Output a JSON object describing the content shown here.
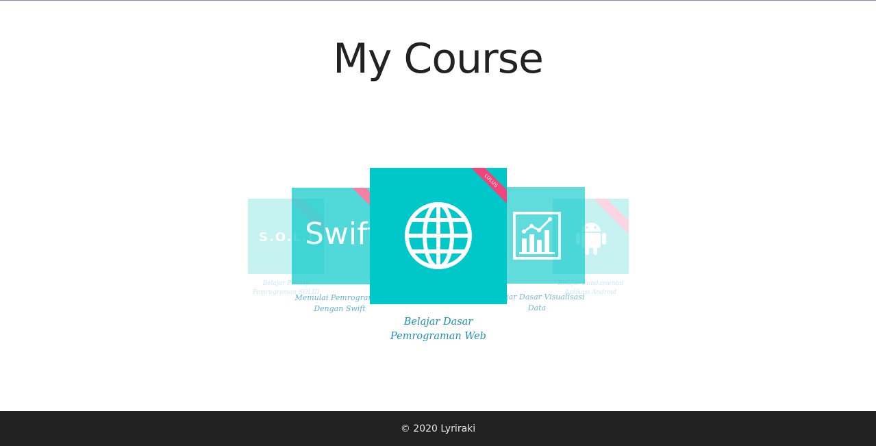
{
  "page": {
    "title": "My Course"
  },
  "colors": {
    "thumb": "#00c8c8",
    "caption": "#1d8fb8",
    "ribbon": "#f0457a",
    "footer_bg": "#212121"
  },
  "courses": [
    {
      "caption": "Belajar Prinsip Pemrograman SOLID",
      "thumb_text": "S.O.L.I",
      "icon": "solid-text-logo"
    },
    {
      "caption": "Memulai Pemrograman Dengan Swift",
      "thumb_text": "Swift",
      "icon": "swift-text-logo"
    },
    {
      "caption": "Belajar Dasar Pemrograman Web",
      "badge": "LULUS",
      "icon": "globe-icon"
    },
    {
      "caption": "Belajar Dasar Visualisasi Data",
      "icon": "bar-chart-icon"
    },
    {
      "caption": "Belajar Fundamental Aplikasi Android",
      "icon": "android-icon"
    }
  ],
  "footer": {
    "text": "© 2020 Lyriraki"
  }
}
